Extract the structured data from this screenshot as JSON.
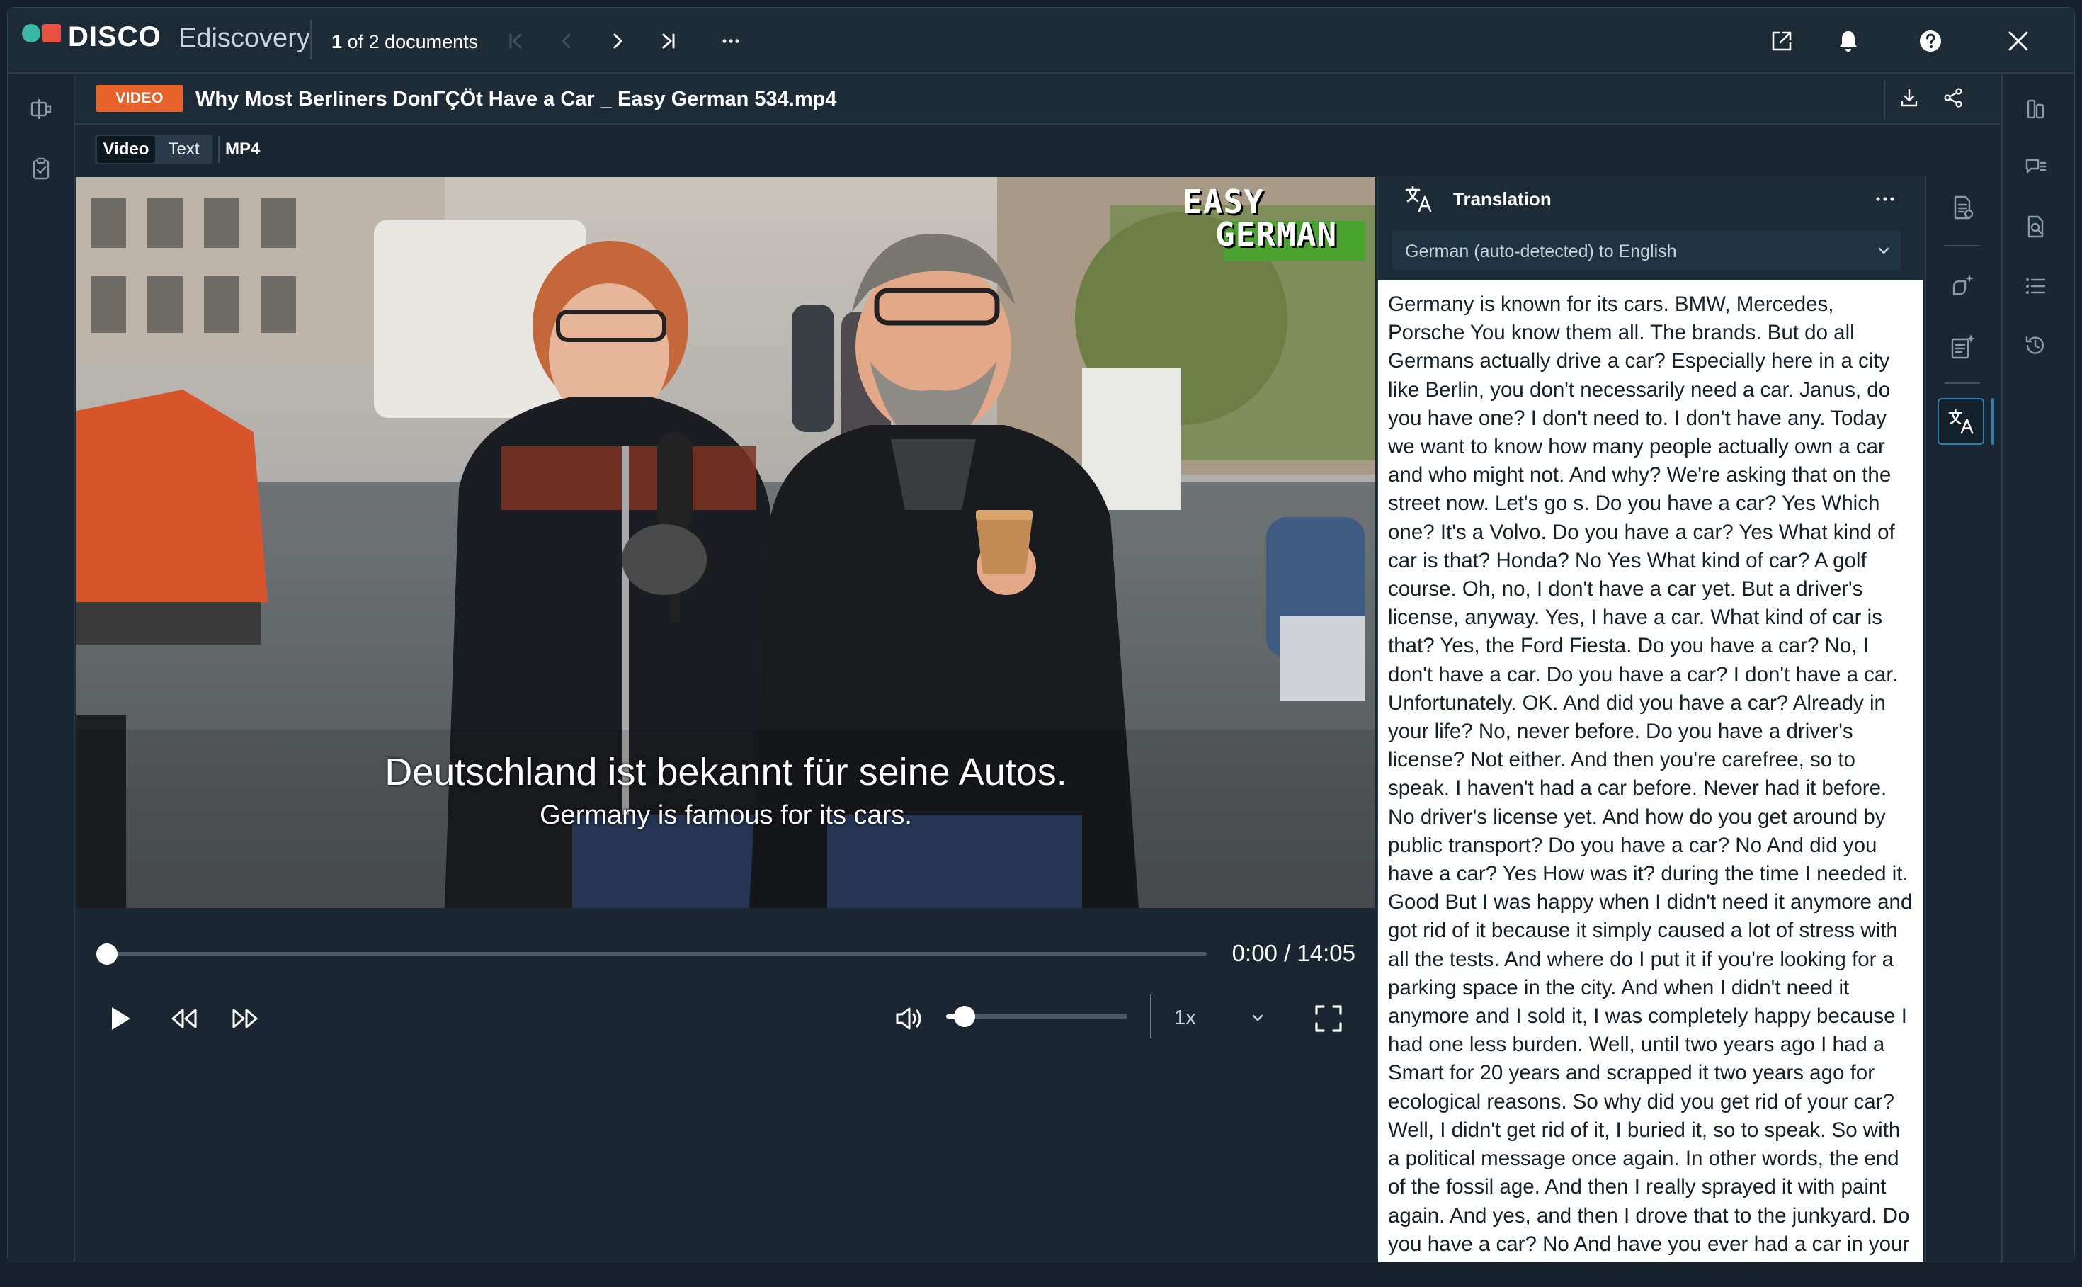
{
  "app": {
    "brand": "DISCO",
    "product": "Ediscovery"
  },
  "doc_nav": {
    "current": "1",
    "rest": "of 2 documents"
  },
  "document": {
    "type_badge": "VIDEO",
    "title": "Why Most Berliners DonΓÇÖt Have a Car _ Easy German 534.mp4"
  },
  "format_tabs": [
    {
      "label": "Video",
      "active": true
    },
    {
      "label": "Text",
      "active": false
    }
  ],
  "format_label": "MP4",
  "video": {
    "watermark_line1": "EASY",
    "watermark_line2": "GERMAN",
    "subtitle_de": "Deutschland ist bekannt für seine Autos.",
    "subtitle_en": "Germany is famous for its cars.",
    "time_display": "0:00 / 14:05",
    "progress_fraction": 0.0,
    "volume_fraction": 0.1,
    "speed": "1x"
  },
  "translation": {
    "title": "Translation",
    "language": "German (auto-detected) to English",
    "text": "Germany is known for its cars. BMW, Mercedes, Porsche You know them all. The brands. But do all Germans actually drive a car? Especially here in a city like Berlin, you don't necessarily need a car. Janus, do you have one? I don't need to. I don't have any. Today we want to know how many people actually own a car and who might not. And why? We're asking that on the street now. Let's go s. Do you have a car? Yes Which one? It's a Volvo. Do you have a car? Yes What kind of car is that? Honda? No Yes What kind of car? A golf course. Oh, no, I don't have a car yet. But a driver's license, anyway. Yes, I have a car. What kind of car is that? Yes, the Ford Fiesta. Do you have a car? No, I don't have a car. Do you have a car? I don't have a car. Unfortunately. OK. And did you have a car? Already in your life? No, never before. Do you have a driver's license? Not either. And then you're carefree, so to speak. I haven't had a car before. Never had it before. No driver's license yet. And how do you get around by public transport? Do you have a car? No And did you have a car? Yes How was it? during the time I needed it. Good But I was happy when I didn't need it anymore and got rid of it because it simply caused a lot of stress with all the tests. And where do I put it if you're looking for a parking space in the city. And when I didn't need it anymore and I sold it, I was completely happy because I had one less burden. Well, until two years ago I had a Smart for 20 years and scrapped it two years ago for ecological reasons. So why did you get rid of your car? Well, I didn't get rid of it, I buried it, so to speak. So with a political message once again. In other words, the end of the fossil age. And then I really sprayed it with paint again. And yes, and then I drove that to the junkyard. Do you have a car? No And have you ever had a car in your life? No, not yet. And what is the reason?"
  },
  "colors": {
    "accent_badge": "#e8622c",
    "logo_teal": "#3bb7a6",
    "logo_red": "#e8503f",
    "active_tool": "#2a7fb8"
  }
}
